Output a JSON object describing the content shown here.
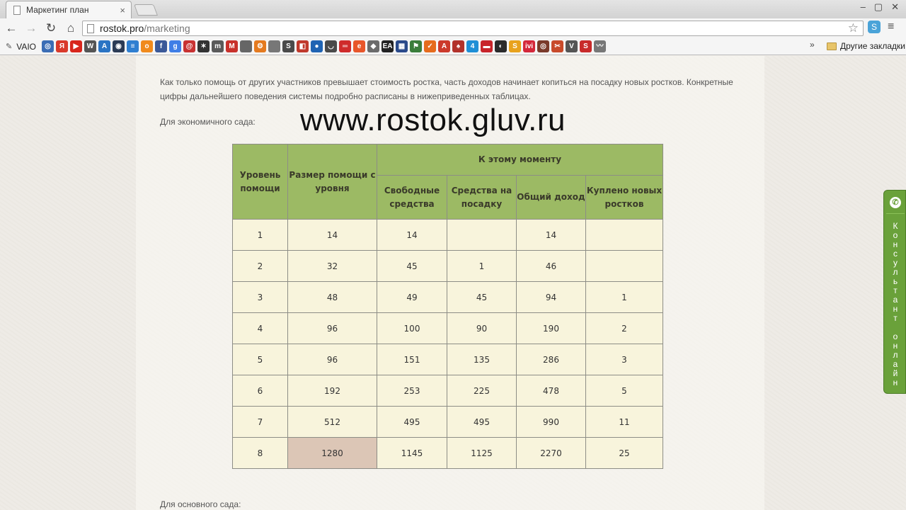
{
  "browser": {
    "tab_title": "Маркетинг план",
    "tab_close": "×",
    "window_controls": [
      "–",
      "▢",
      "✕"
    ],
    "url_host": "rostok.pro",
    "url_path": "/marketing",
    "bookmarks_first": "VAIO",
    "bookmarks_other": "Другие закладки",
    "bookmarks_more": "»",
    "bookmark_icons": [
      {
        "glyph": "◎",
        "color": "#3b6db5"
      },
      {
        "glyph": "Я",
        "color": "#d93a2b"
      },
      {
        "glyph": "▶",
        "color": "#d8261c"
      },
      {
        "glyph": "W",
        "color": "#555555"
      },
      {
        "glyph": "A",
        "color": "#2a74c4"
      },
      {
        "glyph": "◉",
        "color": "#2b3b55"
      },
      {
        "glyph": "≡",
        "color": "#2f7fd1"
      },
      {
        "glyph": "о",
        "color": "#f08a1c"
      },
      {
        "glyph": "f",
        "color": "#3b5998"
      },
      {
        "glyph": "g",
        "color": "#3f7ee6"
      },
      {
        "glyph": "@",
        "color": "#c83232"
      },
      {
        "glyph": "✶",
        "color": "#333333"
      },
      {
        "glyph": "m",
        "color": "#5a5a5a"
      },
      {
        "glyph": "M",
        "color": "#c8312b"
      },
      {
        "glyph": "",
        "color": "#666666"
      },
      {
        "glyph": "⚙",
        "color": "#e47a1f"
      },
      {
        "glyph": "",
        "color": "#777777"
      },
      {
        "glyph": "S",
        "color": "#4a4a4a"
      },
      {
        "glyph": "◧",
        "color": "#c0392b"
      },
      {
        "glyph": "●",
        "color": "#1f63b3"
      },
      {
        "glyph": "◡",
        "color": "#4a4a4a"
      },
      {
        "glyph": "═",
        "color": "#cf2b2b"
      },
      {
        "glyph": "e",
        "color": "#e8562a"
      },
      {
        "glyph": "◆",
        "color": "#6b6b6b"
      },
      {
        "glyph": "EA",
        "color": "#222222"
      },
      {
        "glyph": "▦",
        "color": "#2a4a8a"
      },
      {
        "glyph": "⚑",
        "color": "#3a7d3a"
      },
      {
        "glyph": "✓",
        "color": "#e66b1c"
      },
      {
        "glyph": "A",
        "color": "#cc3a2a"
      },
      {
        "glyph": "♠",
        "color": "#b2322a"
      },
      {
        "glyph": "4",
        "color": "#1e8fd6"
      },
      {
        "glyph": "▬",
        "color": "#c8242a"
      },
      {
        "glyph": "◐",
        "color": "#2b2b2b"
      },
      {
        "glyph": "S",
        "color": "#e8a21c"
      },
      {
        "glyph": "ivi",
        "color": "#d4273a"
      },
      {
        "glyph": "◎",
        "color": "#7a3a2a"
      },
      {
        "glyph": "✂",
        "color": "#c84a2a"
      },
      {
        "glyph": "V",
        "color": "#555555"
      },
      {
        "glyph": "S",
        "color": "#c82a2a"
      },
      {
        "glyph": "〰",
        "color": "#777777"
      }
    ]
  },
  "page": {
    "paragraph": "Как только помощь от других участников превышает стоимость ростка, часть доходов начинает копиться на посадку новых ростков. Конкретные цифры дальнейшего поведения системы подробно расписаны в нижеприведенных таблицах.",
    "eco_heading": "Для экономичного сада:",
    "main_heading": "Для основного сада:",
    "watermark": "www.rostok.gluv.ru",
    "consultant_text": "Консультант онлайн",
    "consultant_icon": "✆"
  },
  "table": {
    "headers": {
      "level": "Уровень помощи",
      "help_size": "Размер помощи с уровня",
      "group": "К этому моменту",
      "free": "Свободные средства",
      "planting": "Средства на посадку",
      "total": "Общий доход",
      "bought": "Куплено новых ростков"
    },
    "rows": [
      [
        "1",
        "14",
        "14",
        "",
        "14",
        ""
      ],
      [
        "2",
        "32",
        "45",
        "1",
        "46",
        ""
      ],
      [
        "3",
        "48",
        "49",
        "45",
        "94",
        "1"
      ],
      [
        "4",
        "96",
        "100",
        "90",
        "190",
        "2"
      ],
      [
        "5",
        "96",
        "151",
        "135",
        "286",
        "3"
      ],
      [
        "6",
        "192",
        "253",
        "225",
        "478",
        "5"
      ],
      [
        "7",
        "512",
        "495",
        "495",
        "990",
        "11"
      ],
      [
        "8",
        "1280",
        "1145",
        "1125",
        "2270",
        "25"
      ]
    ],
    "highlight_color": "#dcc6b6",
    "header_color": "#9cba64",
    "cell_color": "#f8f4dc"
  }
}
